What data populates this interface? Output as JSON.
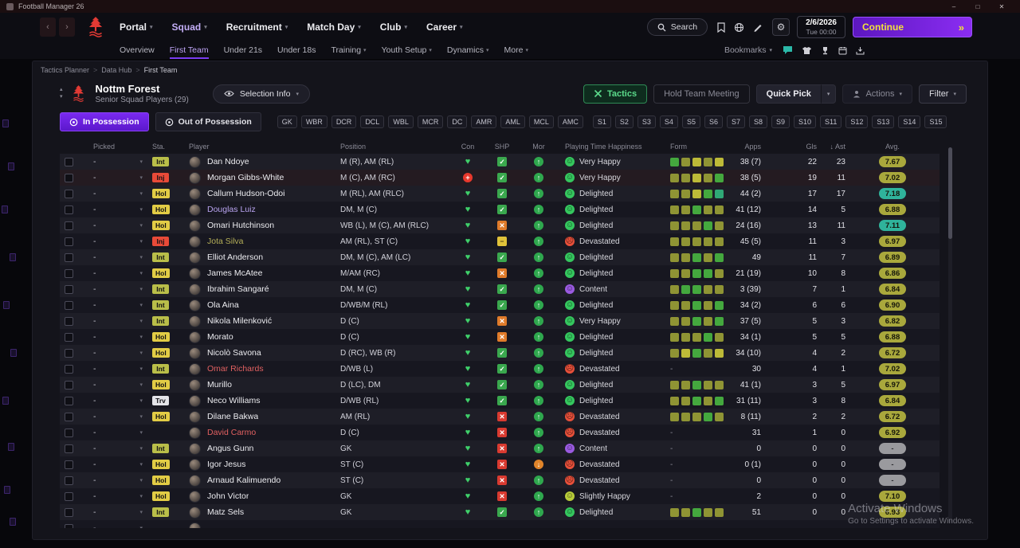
{
  "window": {
    "title": "Football Manager 26",
    "controls": {
      "minimize": "–",
      "maximize": "□",
      "close": "✕"
    }
  },
  "navbar": {
    "menus": [
      {
        "label": "Portal",
        "active": false
      },
      {
        "label": "Squad",
        "active": true
      },
      {
        "label": "Recruitment",
        "active": false
      },
      {
        "label": "Match Day",
        "active": false
      },
      {
        "label": "Club",
        "active": false
      },
      {
        "label": "Career",
        "active": false
      }
    ],
    "search_label": "Search",
    "date_line1": "2/6/2026",
    "date_line2": "Tue 00:00",
    "continue_label": "Continue",
    "continue_arrow": "»"
  },
  "subnav": {
    "items": [
      {
        "label": "Overview",
        "caret": false
      },
      {
        "label": "First Team",
        "caret": false
      },
      {
        "label": "Under 21s",
        "caret": false
      },
      {
        "label": "Under 18s",
        "caret": false
      },
      {
        "label": "Training",
        "caret": true
      },
      {
        "label": "Youth Setup",
        "caret": true
      },
      {
        "label": "Dynamics",
        "caret": true
      },
      {
        "label": "More",
        "caret": true
      }
    ],
    "active_index": 1,
    "bookmarks_label": "Bookmarks"
  },
  "breadcrumb": {
    "items": [
      "Tactics Planner",
      "Data Hub",
      "First Team"
    ],
    "separator": ">"
  },
  "header": {
    "club_name": "Nottm Forest",
    "squad_label": "Senior Squad Players (29)",
    "selection_info_label": "Selection Info",
    "tactics_label": "Tactics",
    "hold_meeting_label": "Hold Team Meeting",
    "quick_pick_label": "Quick Pick",
    "actions_label": "Actions",
    "filter_label": "Filter"
  },
  "possession": {
    "in_label": "In Possession",
    "out_label": "Out of Possession"
  },
  "position_chips": [
    "GK",
    "WBR",
    "DCR",
    "DCL",
    "WBL",
    "MCR",
    "DC",
    "AMR",
    "AML",
    "MCL",
    "AMC"
  ],
  "slot_chips": [
    "S1",
    "S2",
    "S3",
    "S4",
    "S5",
    "S6",
    "S7",
    "S8",
    "S9",
    "S10",
    "S11",
    "S12",
    "S13",
    "S14",
    "S15"
  ],
  "table": {
    "sort_arrow": "↓",
    "columns": [
      {
        "key": "picked",
        "label": "Picked"
      },
      {
        "key": "sta",
        "label": "Sta."
      },
      {
        "key": "player",
        "label": "Player"
      },
      {
        "key": "position",
        "label": "Position"
      },
      {
        "key": "con",
        "label": "Con"
      },
      {
        "key": "shp",
        "label": "SHP"
      },
      {
        "key": "mor",
        "label": "Mor"
      },
      {
        "key": "happy",
        "label": "Playing Time Happiness"
      },
      {
        "key": "form",
        "label": "Form"
      },
      {
        "key": "apps",
        "label": "Apps"
      },
      {
        "key": "gls",
        "label": "Gls"
      },
      {
        "key": "ast",
        "label": "Ast",
        "sorted": true
      },
      {
        "key": "avg",
        "label": "Avg."
      }
    ],
    "rows": [
      {
        "picked": "-",
        "sta": "Int",
        "sta_type": "int",
        "name": "Dan Ndoye",
        "position": "M (R), AM (RL)",
        "con": "heart",
        "shp": "check",
        "mor": "up",
        "happiness": "Very Happy",
        "happy_type": "green",
        "form": [
          "g",
          "o",
          "y",
          "o",
          "y"
        ],
        "apps": "38 (7)",
        "gls": "22",
        "ast": "23",
        "avg": "7.67",
        "avg_type": "olive"
      },
      {
        "picked": "-",
        "sta": "Inj",
        "sta_type": "inj",
        "name": "Morgan Gibbs-White",
        "position": "M (C), AM (RC)",
        "con": "inj",
        "shp": "check",
        "mor": "up",
        "happiness": "Very Happy",
        "happy_type": "green",
        "form": [
          "o",
          "o",
          "y",
          "o",
          "g"
        ],
        "apps": "38 (5)",
        "gls": "19",
        "ast": "11",
        "avg": "7.02",
        "avg_type": "olive",
        "highlight": true
      },
      {
        "picked": "-",
        "sta": "Hol",
        "sta_type": "hol",
        "name": "Callum Hudson-Odoi",
        "position": "M (RL), AM (RLC)",
        "con": "heart",
        "shp": "check",
        "mor": "up",
        "happiness": "Delighted",
        "happy_type": "green",
        "form": [
          "o",
          "o",
          "y",
          "g",
          "t"
        ],
        "apps": "44 (2)",
        "gls": "17",
        "ast": "17",
        "avg": "7.18",
        "avg_type": "teal"
      },
      {
        "picked": "-",
        "sta": "Hol",
        "sta_type": "hol",
        "name": "Douglas Luiz",
        "name_color": "#b9a4f0",
        "position": "DM, M (C)",
        "con": "heart",
        "shp": "check",
        "mor": "up",
        "happiness": "Delighted",
        "happy_type": "green",
        "form": [
          "o",
          "o",
          "g",
          "o",
          "o"
        ],
        "apps": "41 (12)",
        "gls": "14",
        "ast": "5",
        "avg": "6.88",
        "avg_type": "olive"
      },
      {
        "picked": "-",
        "sta": "Hol",
        "sta_type": "hol",
        "name": "Omari Hutchinson",
        "position": "WB (L), M (C), AM (RLC)",
        "con": "heart",
        "shp": "warn",
        "mor": "up",
        "happiness": "Delighted",
        "happy_type": "green",
        "form": [
          "o",
          "o",
          "o",
          "g",
          "o"
        ],
        "apps": "24 (16)",
        "gls": "13",
        "ast": "11",
        "avg": "7.11",
        "avg_type": "teal"
      },
      {
        "picked": "-",
        "sta": "Inj",
        "sta_type": "inj",
        "name": "Jota Silva",
        "name_color": "#b4ae58",
        "position": "AM (RL), ST (C)",
        "con": "heart",
        "shp": "dash",
        "mor": "up",
        "happiness": "Devastated",
        "happy_type": "red",
        "form": [
          "o",
          "o",
          "o",
          "o",
          "o"
        ],
        "apps": "45 (5)",
        "gls": "11",
        "ast": "3",
        "avg": "6.97",
        "avg_type": "olive"
      },
      {
        "picked": "-",
        "sta": "Int",
        "sta_type": "int",
        "name": "Elliot Anderson",
        "position": "DM, M (C), AM (LC)",
        "con": "heart",
        "shp": "check",
        "mor": "up",
        "happiness": "Delighted",
        "happy_type": "green",
        "form": [
          "o",
          "o",
          "g",
          "o",
          "g"
        ],
        "apps": "49",
        "gls": "11",
        "ast": "7",
        "avg": "6.89",
        "avg_type": "olive"
      },
      {
        "picked": "-",
        "sta": "Hol",
        "sta_type": "hol",
        "name": "James McAtee",
        "position": "M/AM (RC)",
        "con": "heart",
        "shp": "warn",
        "mor": "up",
        "happiness": "Delighted",
        "happy_type": "green",
        "form": [
          "o",
          "o",
          "g",
          "g",
          "o"
        ],
        "apps": "21 (19)",
        "gls": "10",
        "ast": "8",
        "avg": "6.86",
        "avg_type": "olive"
      },
      {
        "picked": "-",
        "sta": "Int",
        "sta_type": "int",
        "name": "Ibrahim Sangaré",
        "position": "DM, M (C)",
        "con": "heart",
        "shp": "check",
        "mor": "up",
        "happiness": "Content",
        "happy_type": "purple",
        "form": [
          "o",
          "g",
          "g",
          "o",
          "o"
        ],
        "apps": "3 (39)",
        "gls": "7",
        "ast": "1",
        "avg": "6.84",
        "avg_type": "olive"
      },
      {
        "picked": "-",
        "sta": "Int",
        "sta_type": "int",
        "name": "Ola Aina",
        "position": "D/WB/M (RL)",
        "con": "heart",
        "shp": "check",
        "mor": "up",
        "happiness": "Delighted",
        "happy_type": "green",
        "form": [
          "o",
          "o",
          "g",
          "o",
          "g"
        ],
        "apps": "34 (2)",
        "gls": "6",
        "ast": "6",
        "avg": "6.90",
        "avg_type": "olive"
      },
      {
        "picked": "-",
        "sta": "Int",
        "sta_type": "int",
        "name": "Nikola Milenković",
        "position": "D (C)",
        "con": "heart",
        "shp": "warn",
        "mor": "up",
        "happiness": "Very Happy",
        "happy_type": "green",
        "form": [
          "o",
          "o",
          "g",
          "o",
          "g"
        ],
        "apps": "37 (5)",
        "gls": "5",
        "ast": "3",
        "avg": "6.82",
        "avg_type": "olive"
      },
      {
        "picked": "-",
        "sta": "Hol",
        "sta_type": "hol",
        "name": "Morato",
        "position": "D (C)",
        "con": "heart",
        "shp": "warn",
        "mor": "up",
        "happiness": "Delighted",
        "happy_type": "green",
        "form": [
          "o",
          "o",
          "o",
          "g",
          "o"
        ],
        "apps": "34 (1)",
        "gls": "5",
        "ast": "5",
        "avg": "6.88",
        "avg_type": "olive"
      },
      {
        "picked": "-",
        "sta": "Hol",
        "sta_type": "hol",
        "name": "Nicolò Savona",
        "position": "D (RC), WB (R)",
        "con": "heart",
        "shp": "check",
        "mor": "up",
        "happiness": "Delighted",
        "happy_type": "green",
        "form": [
          "o",
          "y",
          "g",
          "o",
          "y"
        ],
        "apps": "34 (10)",
        "gls": "4",
        "ast": "2",
        "avg": "6.72",
        "avg_type": "olive"
      },
      {
        "picked": "-",
        "sta": "Int",
        "sta_type": "int",
        "name": "Omar Richards",
        "name_color": "#e06060",
        "position": "D/WB (L)",
        "con": "heart",
        "shp": "check",
        "mor": "up",
        "happiness": "Devastated",
        "happy_type": "red",
        "form": "dash",
        "apps": "30",
        "gls": "4",
        "ast": "1",
        "avg": "7.02",
        "avg_type": "olive"
      },
      {
        "picked": "-",
        "sta": "Hol",
        "sta_type": "hol",
        "name": "Murillo",
        "position": "D (LC), DM",
        "con": "heart",
        "shp": "check",
        "mor": "up",
        "happiness": "Delighted",
        "happy_type": "green",
        "form": [
          "o",
          "o",
          "g",
          "o",
          "o"
        ],
        "apps": "41 (1)",
        "gls": "3",
        "ast": "5",
        "avg": "6.97",
        "avg_type": "olive"
      },
      {
        "picked": "-",
        "sta": "Trv",
        "sta_type": "trv",
        "name": "Neco Williams",
        "position": "D/WB (RL)",
        "con": "heart",
        "shp": "check",
        "mor": "up",
        "happiness": "Delighted",
        "happy_type": "green",
        "form": [
          "o",
          "o",
          "g",
          "o",
          "g"
        ],
        "apps": "31 (11)",
        "gls": "3",
        "ast": "8",
        "avg": "6.84",
        "avg_type": "olive"
      },
      {
        "picked": "-",
        "sta": "Hol",
        "sta_type": "hol",
        "name": "Dilane Bakwa",
        "position": "AM (RL)",
        "con": "heart",
        "shp": "cross",
        "mor": "up",
        "happiness": "Devastated",
        "happy_type": "red",
        "form": [
          "o",
          "o",
          "o",
          "g",
          "o"
        ],
        "apps": "8 (11)",
        "gls": "2",
        "ast": "2",
        "avg": "6.72",
        "avg_type": "olive"
      },
      {
        "picked": "-",
        "sta": "",
        "sta_type": "",
        "name": "David Carmo",
        "name_color": "#e06060",
        "position": "D (C)",
        "con": "heart",
        "shp": "cross",
        "mor": "up",
        "happiness": "Devastated",
        "happy_type": "red",
        "form": "dash",
        "apps": "31",
        "gls": "1",
        "ast": "0",
        "avg": "6.92",
        "avg_type": "olive"
      },
      {
        "picked": "-",
        "sta": "Int",
        "sta_type": "int",
        "name": "Angus Gunn",
        "position": "GK",
        "con": "heart",
        "shp": "cross",
        "mor": "up",
        "happiness": "Content",
        "happy_type": "purple",
        "form": "dash",
        "apps": "0",
        "gls": "0",
        "ast": "0",
        "avg": "-",
        "avg_type": "gray"
      },
      {
        "picked": "-",
        "sta": "Hol",
        "sta_type": "hol",
        "name": "Igor Jesus",
        "position": "ST (C)",
        "con": "heart",
        "shp": "cross",
        "mor": "down",
        "happiness": "Devastated",
        "happy_type": "red",
        "form": "dash",
        "apps": "0 (1)",
        "gls": "0",
        "ast": "0",
        "avg": "-",
        "avg_type": "gray"
      },
      {
        "picked": "-",
        "sta": "Hol",
        "sta_type": "hol",
        "name": "Arnaud Kalimuendo",
        "position": "ST (C)",
        "con": "heart",
        "shp": "cross",
        "mor": "up",
        "happiness": "Devastated",
        "happy_type": "red",
        "form": "dash",
        "apps": "0",
        "gls": "0",
        "ast": "0",
        "avg": "-",
        "avg_type": "gray"
      },
      {
        "picked": "-",
        "sta": "Hol",
        "sta_type": "hol",
        "name": "John Victor",
        "position": "GK",
        "con": "heart",
        "shp": "cross",
        "mor": "up",
        "happiness": "Slightly Happy",
        "happy_type": "lime",
        "form": "dash",
        "apps": "2",
        "gls": "0",
        "ast": "0",
        "avg": "7.10",
        "avg_type": "olive"
      },
      {
        "picked": "-",
        "sta": "Int",
        "sta_type": "int",
        "name": "Matz Sels",
        "position": "GK",
        "con": "heart",
        "shp": "check",
        "mor": "up",
        "happiness": "Delighted",
        "happy_type": "green",
        "form": [
          "o",
          "o",
          "g",
          "o",
          "o"
        ],
        "apps": "51",
        "gls": "0",
        "ast": "0",
        "avg": "6.93",
        "avg_type": "olive"
      },
      {
        "picked": "-",
        "sta": "",
        "sta_type": "",
        "name": "",
        "position": "",
        "con": "",
        "shp": "",
        "mor": "",
        "happiness": "",
        "happy_type": "",
        "form": null,
        "apps": "",
        "gls": "",
        "ast": "",
        "avg": "",
        "avg_type": "",
        "partial": true
      }
    ]
  },
  "watermark": {
    "line1": "Activate Windows",
    "line2": "Go to Settings to activate Windows."
  }
}
